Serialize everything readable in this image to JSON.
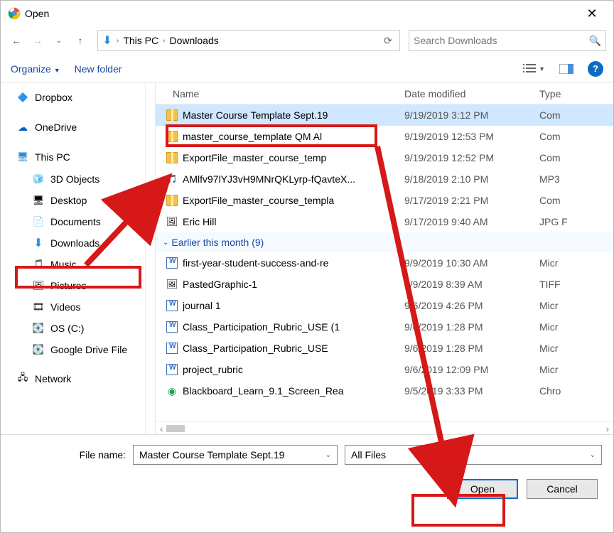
{
  "window": {
    "title": "Open"
  },
  "breadcrumb": {
    "root": "This PC",
    "current": "Downloads"
  },
  "search": {
    "placeholder": "Search Downloads"
  },
  "toolbar": {
    "organize": "Organize",
    "newfolder": "New folder"
  },
  "sidebar": {
    "dropbox": "Dropbox",
    "onedrive": "OneDrive",
    "thispc": "This PC",
    "sub": {
      "objects3d": "3D Objects",
      "desktop": "Desktop",
      "documents": "Documents",
      "downloads": "Downloads",
      "music": "Music",
      "pictures": "Pictures",
      "videos": "Videos",
      "osc": "OS (C:)",
      "gdrive": "Google Drive File"
    },
    "network": "Network"
  },
  "columns": {
    "name": "Name",
    "date": "Date modified",
    "type": "Type"
  },
  "files_recent": [
    {
      "name": "Master Course Template Sept.19",
      "date": "9/19/2019 3:12 PM",
      "type": "Com",
      "icon": "zip",
      "selected": true
    },
    {
      "name": "master_course_template QM Al",
      "date": "9/19/2019 12:53 PM",
      "type": "Com",
      "icon": "zip"
    },
    {
      "name": "ExportFile_master_course_temp",
      "date": "9/19/2019 12:52 PM",
      "type": "Com",
      "icon": "zip"
    },
    {
      "name": "AMlfv97lYJ3vH9MNrQKLyrp-fQavteX...",
      "date": "9/18/2019 2:10 PM",
      "type": "MP3",
      "icon": "audio"
    },
    {
      "name": "ExportFile_master_course_templa",
      "date": "9/17/2019 2:21 PM",
      "type": "Com",
      "icon": "zip"
    },
    {
      "name": "Eric Hill",
      "date": "9/17/2019 9:40 AM",
      "type": "JPG F",
      "icon": "img"
    }
  ],
  "group_label": "Earlier this month (9)",
  "files_earlier": [
    {
      "name": "first-year-student-success-and-re",
      "date": "9/9/2019 10:30 AM",
      "type": "Micr",
      "icon": "doc"
    },
    {
      "name": "PastedGraphic-1",
      "date": "9/9/2019 8:39 AM",
      "type": "TIFF",
      "icon": "img"
    },
    {
      "name": "journal 1",
      "date": "9/6/2019 4:26 PM",
      "type": "Micr",
      "icon": "doc"
    },
    {
      "name": "Class_Participation_Rubric_USE (1",
      "date": "9/6/2019 1:28 PM",
      "type": "Micr",
      "icon": "doc"
    },
    {
      "name": "Class_Participation_Rubric_USE",
      "date": "9/6/2019 1:28 PM",
      "type": "Micr",
      "icon": "doc"
    },
    {
      "name": "project_rubric",
      "date": "9/6/2019 12:09 PM",
      "type": "Micr",
      "icon": "doc"
    },
    {
      "name": "Blackboard_Learn_9.1_Screen_Rea",
      "date": "9/5/2019 3:33 PM",
      "type": "Chro",
      "icon": "chrome"
    }
  ],
  "filename_label": "File name:",
  "filename_value": "Master Course Template Sept.19",
  "filter_value": "All Files",
  "buttons": {
    "open": "Open",
    "cancel": "Cancel"
  }
}
